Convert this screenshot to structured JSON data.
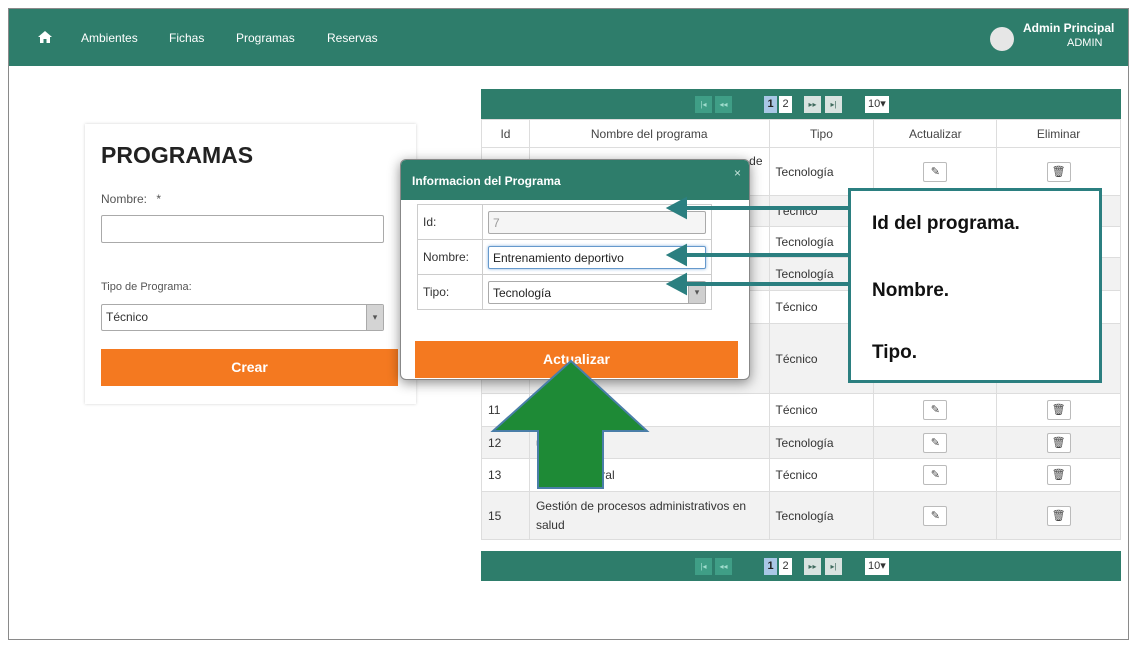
{
  "navbar": {
    "home_icon": "home-icon",
    "links": [
      "Ambientes",
      "Fichas",
      "Programas",
      "Reservas"
    ],
    "user_name": "Admin Principal",
    "user_role": "ADMIN"
  },
  "form": {
    "title": "PROGRAMAS",
    "name_label": "Nombre:",
    "required_mark": "*",
    "name_value": "",
    "type_label": "Tipo de Programa:",
    "type_value": "Técnico",
    "create_label": "Crear"
  },
  "pager": {
    "pages": [
      "1",
      "2"
    ],
    "active_page": "1",
    "page_size": "10"
  },
  "table": {
    "headers": [
      "Id",
      "Nombre del programa",
      "Tipo",
      "Actualizar",
      "Eliminar"
    ],
    "rows": [
      {
        "id": "",
        "name": "de",
        "type": "Tecnología"
      },
      {
        "id": "",
        "name": "",
        "type": "Técnico"
      },
      {
        "id": "",
        "name": "",
        "type": "Tecnología"
      },
      {
        "id": "",
        "name": "",
        "type": "Tecnología"
      },
      {
        "id": "",
        "name": "",
        "type": "Técnico"
      },
      {
        "id": "",
        "name": "",
        "type": "Técnico"
      },
      {
        "id": "11",
        "name": "",
        "type": "Técnico"
      },
      {
        "id": "12",
        "name": "umanos",
        "type": "Tecnología"
      },
      {
        "id": "13",
        "name": "Mecánica rural",
        "type": "Técnico"
      },
      {
        "id": "15",
        "name": "Gestión de procesos administrativos en salud",
        "type": "Tecnología"
      }
    ]
  },
  "modal": {
    "title": "Informacion del Programa",
    "close_icon": "×",
    "id_label": "Id:",
    "id_value": "7",
    "name_label": "Nombre:",
    "name_value": "Entrenamiento deportivo",
    "type_label": "Tipo:",
    "type_value": "Tecnología",
    "update_label": "Actualizar"
  },
  "annotation": {
    "line1": "Id del  programa.",
    "line2": "Nombre.",
    "line3": "Tipo."
  },
  "colors": {
    "brand": "#2e7d6b",
    "accent": "#f47920",
    "callout": "#2b7f80",
    "big_arrow": "#1e8a36"
  }
}
